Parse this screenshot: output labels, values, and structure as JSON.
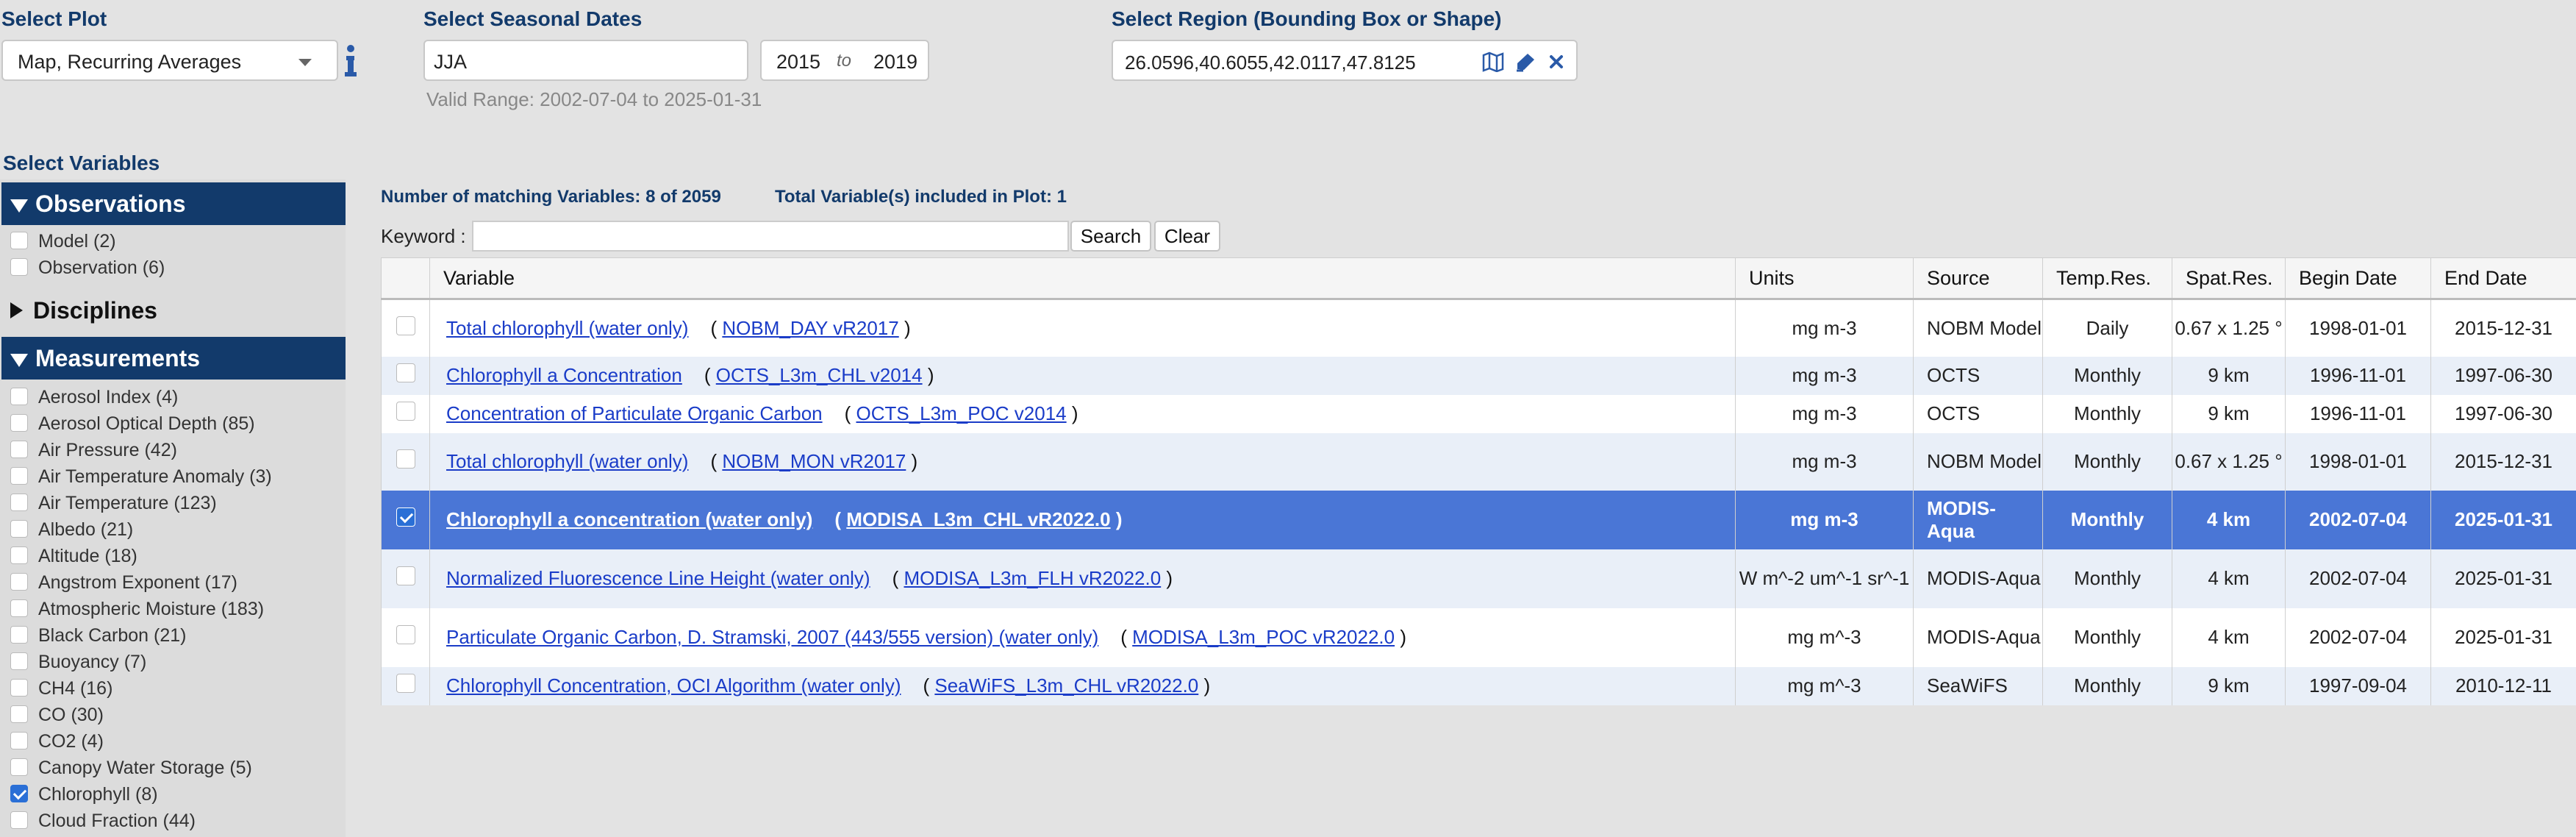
{
  "plot": {
    "label": "Select Plot",
    "value": "Map, Recurring Averages"
  },
  "season": {
    "label": "Select Seasonal Dates",
    "value": "JJA",
    "from_year": "2015",
    "to_word": "to",
    "to_year": "2019",
    "valid_range": "Valid Range: 2002-07-04 to 2025-01-31"
  },
  "region": {
    "label": "Select Region (Bounding Box or Shape)",
    "value": "26.0596,40.6055,42.0117,47.8125"
  },
  "sidebar": {
    "title": "Select Variables",
    "observations": {
      "title": "Observations",
      "items": [
        {
          "label": "Model (2)",
          "checked": false
        },
        {
          "label": "Observation (6)",
          "checked": false
        }
      ]
    },
    "disciplines": {
      "title": "Disciplines"
    },
    "measurements": {
      "title": "Measurements",
      "items": [
        {
          "label": "Aerosol Index (4)",
          "checked": false
        },
        {
          "label": "Aerosol Optical Depth (85)",
          "checked": false
        },
        {
          "label": "Air Pressure (42)",
          "checked": false
        },
        {
          "label": "Air Temperature Anomaly (3)",
          "checked": false
        },
        {
          "label": "Air Temperature (123)",
          "checked": false
        },
        {
          "label": "Albedo (21)",
          "checked": false
        },
        {
          "label": "Altitude (18)",
          "checked": false
        },
        {
          "label": "Angstrom Exponent (17)",
          "checked": false
        },
        {
          "label": "Atmospheric Moisture (183)",
          "checked": false
        },
        {
          "label": "Black Carbon (21)",
          "checked": false
        },
        {
          "label": "Buoyancy (7)",
          "checked": false
        },
        {
          "label": "CH4 (16)",
          "checked": false
        },
        {
          "label": "CO (30)",
          "checked": false
        },
        {
          "label": "CO2 (4)",
          "checked": false
        },
        {
          "label": "Canopy Water Storage (5)",
          "checked": false
        },
        {
          "label": "Chlorophyll (8)",
          "checked": true
        },
        {
          "label": "Cloud Fraction (44)",
          "checked": false
        }
      ]
    }
  },
  "main": {
    "match_count": "Number of matching Variables: 8 of 2059",
    "total_included": "Total Variable(s) included in Plot: 1",
    "keyword_label": "Keyword :",
    "keyword_value": "",
    "search_label": "Search",
    "clear_label": "Clear"
  },
  "table": {
    "headers": [
      "",
      "Variable",
      "Units",
      "Source",
      "Temp.Res.",
      "Spat.Res.",
      "Begin Date",
      "End Date"
    ],
    "rows": [
      {
        "checked": false,
        "variable": "Total chlorophyll (water only)",
        "product": "NOBM_DAY vR2017",
        "units": "mg m-3",
        "source": "NOBM Model",
        "temp": "Daily",
        "spat": "0.67 x 1.25 °",
        "begin": "1998-01-01",
        "end": "2015-12-31"
      },
      {
        "checked": false,
        "variable": "Chlorophyll a Concentration",
        "product": "OCTS_L3m_CHL v2014",
        "units": "mg m-3",
        "source": "OCTS",
        "temp": "Monthly",
        "spat": "9 km",
        "begin": "1996-11-01",
        "end": "1997-06-30"
      },
      {
        "checked": false,
        "variable": "Concentration of Particulate Organic Carbon",
        "product": "OCTS_L3m_POC v2014",
        "units": "mg m-3",
        "source": "OCTS",
        "temp": "Monthly",
        "spat": "9 km",
        "begin": "1996-11-01",
        "end": "1997-06-30"
      },
      {
        "checked": false,
        "variable": "Total chlorophyll (water only)",
        "product": "NOBM_MON vR2017",
        "units": "mg m-3",
        "source": "NOBM Model",
        "temp": "Monthly",
        "spat": "0.67 x 1.25 °",
        "begin": "1998-01-01",
        "end": "2015-12-31"
      },
      {
        "checked": true,
        "variable": "Chlorophyll a concentration (water only)",
        "product": "MODISA_L3m_CHL vR2022.0",
        "units": "mg m-3",
        "source": "MODIS-Aqua",
        "temp": "Monthly",
        "spat": "4 km",
        "begin": "2002-07-04",
        "end": "2025-01-31"
      },
      {
        "checked": false,
        "variable": "Normalized Fluorescence Line Height (water only)",
        "product": "MODISA_L3m_FLH vR2022.0",
        "units": "W m^-2 um^-1 sr^-1",
        "source": "MODIS-Aqua",
        "temp": "Monthly",
        "spat": "4 km",
        "begin": "2002-07-04",
        "end": "2025-01-31"
      },
      {
        "checked": false,
        "variable": "Particulate Organic Carbon, D. Stramski, 2007 (443/555 version) (water only)",
        "product": "MODISA_L3m_POC vR2022.0",
        "units": "mg m^-3",
        "source": "MODIS-Aqua",
        "temp": "Monthly",
        "spat": "4 km",
        "begin": "2002-07-04",
        "end": "2025-01-31"
      },
      {
        "checked": false,
        "variable": "Chlorophyll Concentration, OCI Algorithm (water only)",
        "product": "SeaWiFS_L3m_CHL vR2022.0",
        "units": "mg m^-3",
        "source": "SeaWiFS",
        "temp": "Monthly",
        "spat": "9 km",
        "begin": "1997-09-04",
        "end": "2010-12-11"
      }
    ]
  },
  "colors": {
    "header_blue": "#123a6b",
    "selected_row": "#4a76d6",
    "link": "#1a3cc8",
    "stripe": "#e9eff8"
  },
  "icons": [
    "info-icon",
    "chevron-down-icon",
    "map-icon",
    "draw-shape-icon",
    "close-icon",
    "checkbox-icon"
  ]
}
